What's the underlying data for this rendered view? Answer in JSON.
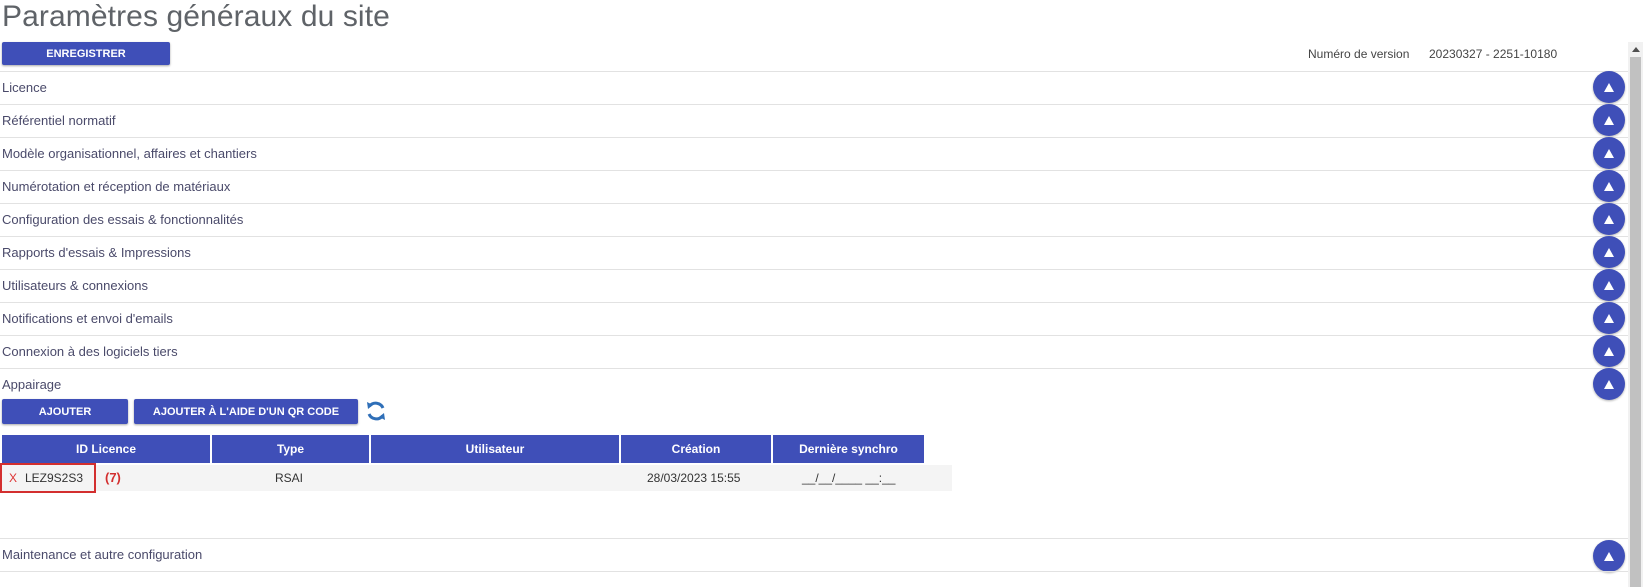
{
  "page": {
    "title": "Paramètres généraux du site"
  },
  "toolbar": {
    "save_label": "ENREGISTRER"
  },
  "version": {
    "label": "Numéro de version",
    "value": "20230327 - 2251-10180"
  },
  "sections": [
    {
      "label": "Licence"
    },
    {
      "label": "Référentiel normatif"
    },
    {
      "label": "Modèle organisationnel, affaires et chantiers"
    },
    {
      "label": "Numérotation et réception de matériaux"
    },
    {
      "label": "Configuration des essais & fonctionnalités"
    },
    {
      "label": "Rapports d'essais & Impressions"
    },
    {
      "label": "Utilisateurs & connexions"
    },
    {
      "label": "Notifications et envoi d'emails"
    },
    {
      "label": "Connexion à des logiciels tiers"
    },
    {
      "label": "Appairage"
    },
    {
      "label": "Maintenance et autre configuration"
    }
  ],
  "appairage": {
    "add_label": "AJOUTER",
    "add_qr_label": "AJOUTER À L'AIDE D'UN QR CODE",
    "table": {
      "columns": [
        "ID Licence",
        "Type",
        "Utilisateur",
        "Création",
        "Dernière synchro"
      ],
      "rows": [
        {
          "delete": "X",
          "id": "LEZ9S2S3",
          "type": "RSAI",
          "user": "",
          "created": "28/03/2023 15:55",
          "last_sync": "__/__/____ __:__"
        }
      ]
    },
    "annotation": "(7)"
  },
  "colors": {
    "accent": "#3f4fb8",
    "highlight": "#d32f2f"
  },
  "icons": {
    "collapse": "triangle-up-icon",
    "refresh": "refresh-icon"
  }
}
